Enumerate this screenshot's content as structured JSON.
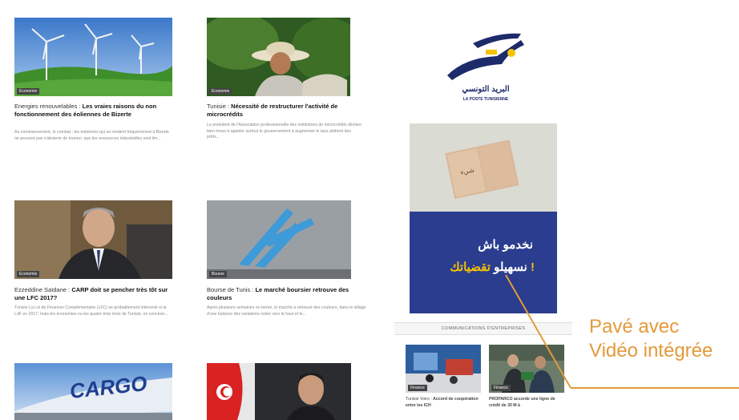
{
  "articles": [
    {
      "tag": "Economie",
      "title_prefix": "Energies renouvelables : ",
      "title_bold": "Les vraies raisons du non fonctionnement des éoliennes de Bizerte",
      "excerpt": "Au commencement, le combat : les éoliennes qui se rendent fréquemment à Bizerte ne peuvent pas s'abstenir de tourner, que les ressources industrielles sont lim..."
    },
    {
      "tag": "Economie",
      "title_prefix": "Tunisie : ",
      "title_bold": "Nécessité de restructurer l'activité de microcrédits",
      "excerpt": "Le président de l'Association professionnelle des institutions de microcrédits déclare bien tenus à appeler surtout le gouvernement à augmenter le taux plafond des prêts..."
    },
    {
      "tag": "Economie",
      "title_prefix": "Ezzeddine Saïdane : ",
      "title_bold": "CARP doit se pencher très tôt sur une LFC 2017?",
      "excerpt": "Tunisie La Loi de Finances Complémentaire (LFC) se probablement intervenir si la LdF en 2017, mais les économies ou les quatre trois mois de Tunisie, en conclure..."
    },
    {
      "tag": "Bourse",
      "title_prefix": "Bourse de Tunis : ",
      "title_bold": "Le marché boursier retrouve des couleurs",
      "excerpt": "Après plusieurs semaines en berne, le marché a retrouvé des couleurs, dans le sillage d'une balance des variations notée vers le haut et le..."
    },
    {
      "tag": "",
      "title_prefix": "",
      "title_bold": "",
      "excerpt": ""
    },
    {
      "tag": "",
      "title_prefix": "",
      "title_bold": "",
      "excerpt": ""
    }
  ],
  "logo": {
    "arabic": "البريد التونسي",
    "french": "LA POSTE TUNISIENNE"
  },
  "ad": {
    "line1": "نخدمو باش",
    "line2_white": "نسهيلو",
    "line2_yellow": "تقضياتك !"
  },
  "communications": {
    "header": "COMMUNICATIONS D'ENTREPRISES",
    "items": [
      {
        "tag": "Finance",
        "title_prefix": "Tunisie Voiro : ",
        "title_bold": "Accord de coopération entre les ICH"
      },
      {
        "tag": "Finance",
        "title_prefix": "",
        "title_bold": "PROPARCO accorde une ligne de crédit de 30 M à"
      }
    ]
  },
  "annotation": {
    "line1": "Pavé avec",
    "line2": "Vidéo intégrée"
  },
  "colors": {
    "accent_orange": "#e39a3a",
    "ad_blue": "#2b3d8f",
    "ad_yellow": "#f5c200",
    "logo_blue": "#1d2b6b"
  }
}
